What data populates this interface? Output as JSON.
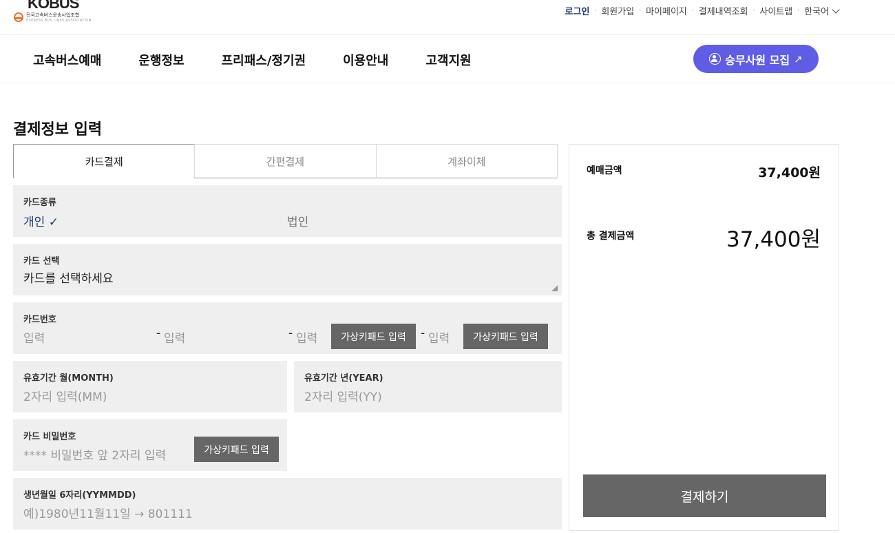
{
  "logo": {
    "brand": "KOBUS",
    "subtitle": "전국고속버스운송사업조합",
    "subtitle_en": "EXPRESS BUS LINES ASSOCIATION"
  },
  "util_nav": [
    "로그인",
    "회원가입",
    "마이페이지",
    "결제내역조회",
    "사이트맵"
  ],
  "language": "한국어",
  "gnb": [
    "고속버스예매",
    "운행정보",
    "프리패스/정기권",
    "이용안내",
    "고객지원"
  ],
  "recruit_button": "승무사원 모집",
  "page_title": "결제정보 입력",
  "tabs": [
    "카드결제",
    "간편결제",
    "계좌이체"
  ],
  "active_tab": "카드결제",
  "card_type": {
    "label": "카드종류",
    "personal": "개인",
    "check": "✓",
    "corporate": "법인"
  },
  "card_select": {
    "label": "카드 선택",
    "value": "카드를 선택하세요"
  },
  "card_number": {
    "label": "카드번호",
    "placeholder": "입력",
    "dash": "-",
    "keypad": "가상키패드 입력"
  },
  "expiry_month": {
    "label": "유효기간 월(MONTH)",
    "placeholder": "2자리 입력(MM)"
  },
  "expiry_year": {
    "label": "유효기간 년(YEAR)",
    "placeholder": "2자리 입력(YY)"
  },
  "card_password": {
    "label": "카드 비밀번호",
    "placeholder": "**** 비밀번호 앞 2자리 입력",
    "keypad": "가상키패드 입력"
  },
  "birth": {
    "label": "생년월일 6자리(YYMMDD)",
    "placeholder": "예)1980년11월11일 → 801111"
  },
  "summary": {
    "ticket_label": "예매금액",
    "ticket_amount": "37,400원",
    "total_label": "총 결제금액",
    "total_amount": "37,400원"
  },
  "pay_button": "결제하기",
  "colors": {
    "accent": "#5f5ce6",
    "button_gray": "#666666",
    "field_bg": "#efefef",
    "selected_text": "#1a3a6e"
  }
}
